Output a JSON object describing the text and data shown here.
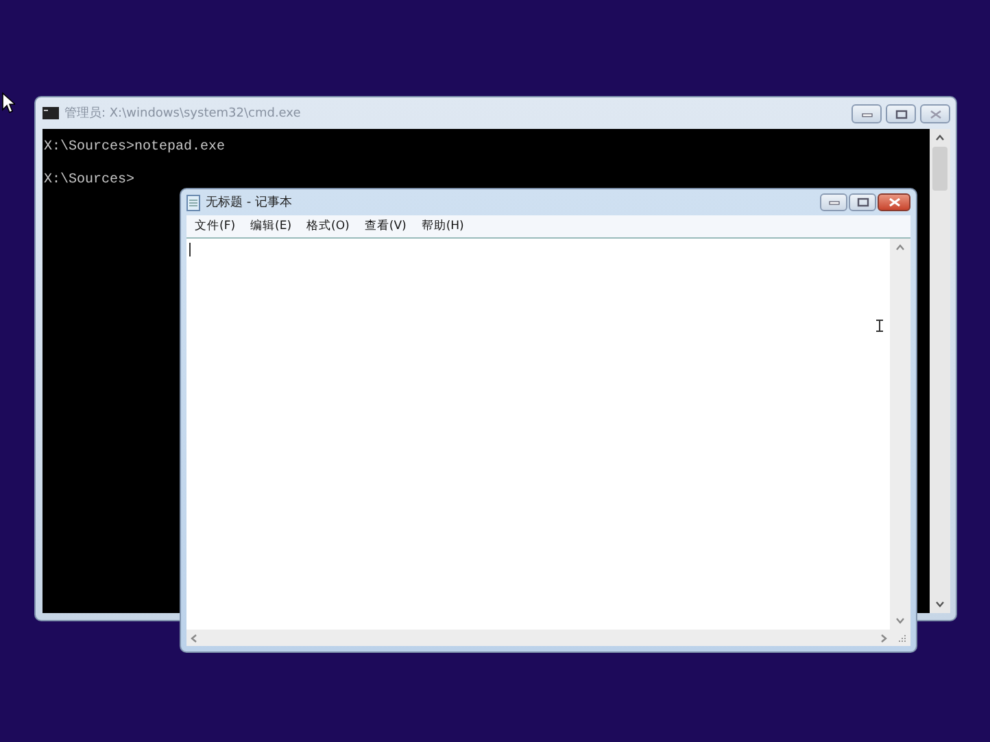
{
  "console_window": {
    "title": "管理员: X:\\windows\\system32\\cmd.exe",
    "lines": [
      "X:\\Sources>notepad.exe",
      "X:\\Sources>"
    ]
  },
  "notepad_window": {
    "title": "无标题 - 记事本",
    "menu": [
      "文件(F)",
      "编辑(E)",
      "格式(O)",
      "查看(V)",
      "帮助(H)"
    ]
  }
}
